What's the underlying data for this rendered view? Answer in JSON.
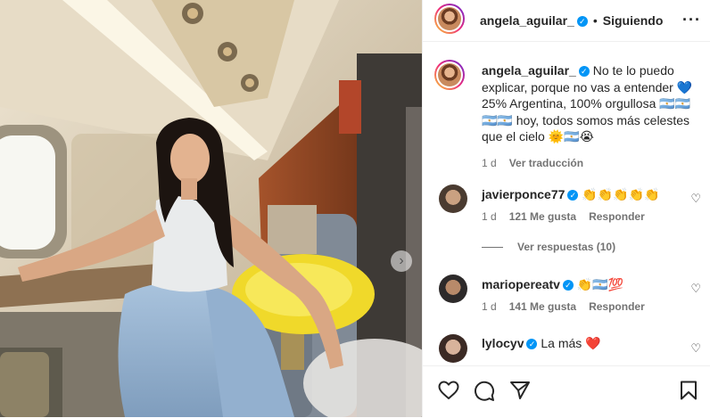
{
  "header": {
    "username": "angela_aguilar_",
    "follow_label": "Siguiendo",
    "separator": "•"
  },
  "caption": {
    "username": "angela_aguilar_",
    "text": "No te lo puedo explicar, porque no vas a entender 💙 25% Argentina, 100% orgullosa 🇦🇷🇦🇷🇦🇷🇦🇷 hoy, todos somos más celestes que el cielo 🌞🇦🇷😭",
    "time": "1 d",
    "translate_label": "Ver traducción"
  },
  "comments": [
    {
      "username": "javierponce77",
      "text": "👏👏👏👏👏",
      "time": "1 d",
      "likes": "121 Me gusta",
      "reply_label": "Responder"
    },
    {
      "username": "mariopereatv",
      "text": "👏🇦🇷💯",
      "time": "1 d",
      "likes": "141 Me gusta",
      "reply_label": "Responder"
    },
    {
      "username": "lylocyv",
      "text": "La más ❤️"
    }
  ],
  "view_replies_label": "Ver respuestas (10)",
  "icons": {
    "more": "more-options-icon",
    "heart": "heart-icon",
    "comment": "comment-icon",
    "share": "share-icon",
    "save": "bookmark-icon",
    "verified": "verified-badge-icon",
    "next": "chevron-right-icon"
  },
  "colors": {
    "verified": "#0095f6",
    "muted": "#737373",
    "text": "#262626"
  }
}
